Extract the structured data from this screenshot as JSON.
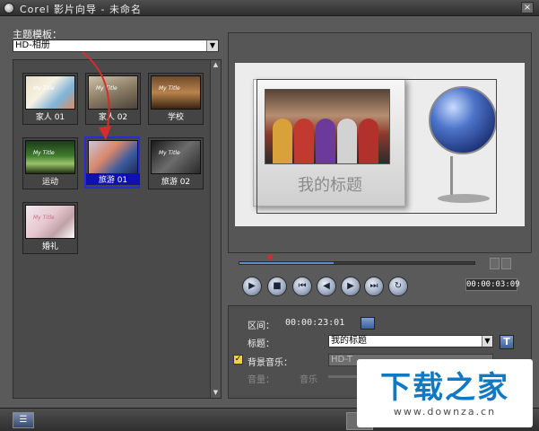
{
  "window": {
    "title": "Corel 影片向导 - 未命名",
    "close_label": "×"
  },
  "theme": {
    "label": "主题模板：",
    "selected": "HD-相册"
  },
  "thumbnails": [
    {
      "label": "家人 01",
      "overlay": "My Title"
    },
    {
      "label": "家人 02",
      "overlay": "My Title"
    },
    {
      "label": "学校",
      "overlay": "My Title"
    },
    {
      "label": "运动",
      "overlay": "My Title"
    },
    {
      "label": "旅游 01",
      "overlay": ""
    },
    {
      "label": "旅游 02",
      "overlay": "My Title"
    },
    {
      "label": "婚礼",
      "overlay": "My Title"
    }
  ],
  "preview": {
    "caption": "我的标题"
  },
  "playback": {
    "timecode": "00:00:03:09",
    "progress": 0.4,
    "controls": [
      "play",
      "stop",
      "go-to-start",
      "previous-frame",
      "next-frame",
      "go-to-end",
      "repeat"
    ]
  },
  "properties": {
    "duration_label": "区间：",
    "duration_value": "00:00:23:01",
    "title_label": "标题：",
    "title_value": "我的标题",
    "music_label": "背景音乐：",
    "music_value": "HD-T",
    "volume_label": "音量：",
    "music_short": "音乐",
    "music_enabled": true
  },
  "watermark": {
    "main": "下载之家",
    "sub": "www.downza.cn"
  },
  "colors": {
    "accent": "#0f79c4",
    "selected": "#1010b0",
    "arrow": "#d52d2d"
  }
}
